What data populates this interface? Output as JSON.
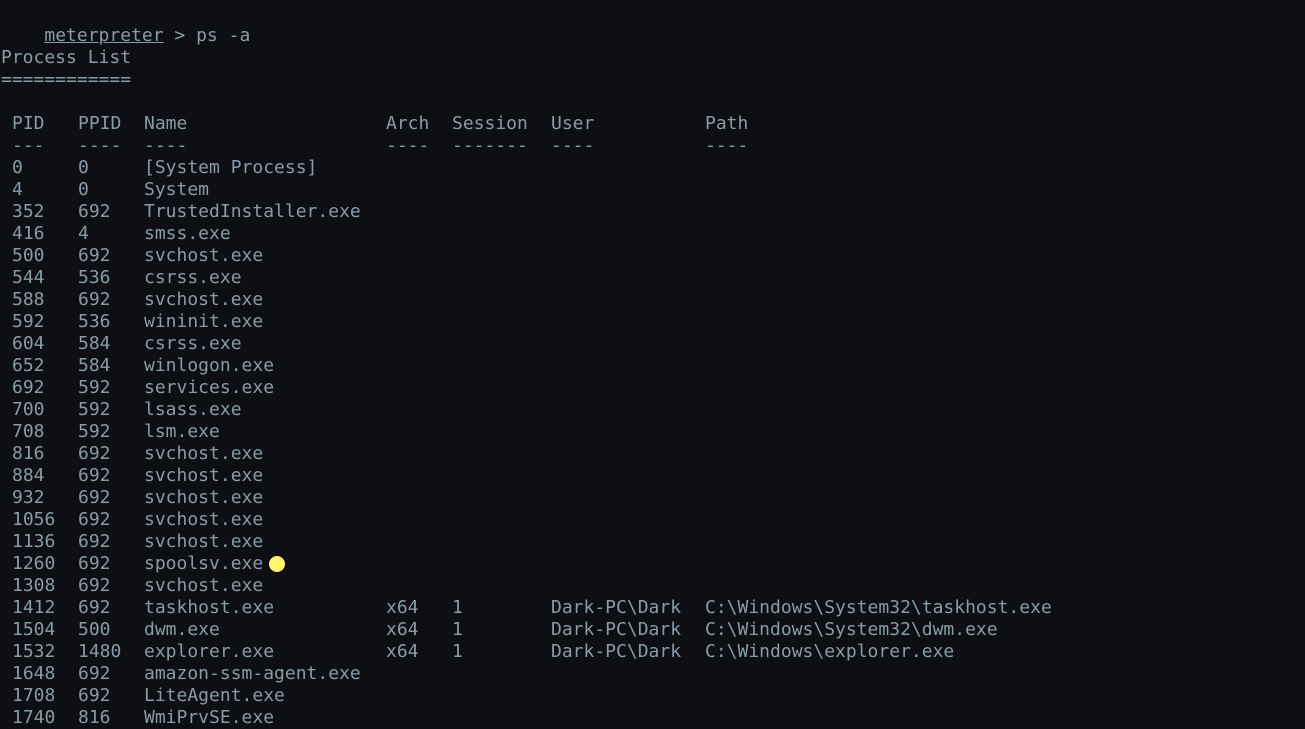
{
  "prompt": {
    "name": "meterpreter",
    "separator": " > ",
    "command": "ps -a"
  },
  "title": "Process List",
  "title_rule": "============",
  "columns": {
    "pid": "PID",
    "ppid": "PPID",
    "name": "Name",
    "arch": "Arch",
    "session": "Session",
    "user": "User",
    "path": "Path"
  },
  "dividers": {
    "pid": "---",
    "ppid": "----",
    "name": "----",
    "arch": "----",
    "session": "-------",
    "user": "----",
    "path": "----"
  },
  "rows": [
    {
      "pid": "0",
      "ppid": "0",
      "name": "[System Process]",
      "arch": "",
      "session": "",
      "user": "",
      "path": ""
    },
    {
      "pid": "4",
      "ppid": "0",
      "name": "System",
      "arch": "",
      "session": "",
      "user": "",
      "path": ""
    },
    {
      "pid": "352",
      "ppid": "692",
      "name": "TrustedInstaller.exe",
      "arch": "",
      "session": "",
      "user": "",
      "path": ""
    },
    {
      "pid": "416",
      "ppid": "4",
      "name": "smss.exe",
      "arch": "",
      "session": "",
      "user": "",
      "path": ""
    },
    {
      "pid": "500",
      "ppid": "692",
      "name": "svchost.exe",
      "arch": "",
      "session": "",
      "user": "",
      "path": ""
    },
    {
      "pid": "544",
      "ppid": "536",
      "name": "csrss.exe",
      "arch": "",
      "session": "",
      "user": "",
      "path": ""
    },
    {
      "pid": "588",
      "ppid": "692",
      "name": "svchost.exe",
      "arch": "",
      "session": "",
      "user": "",
      "path": ""
    },
    {
      "pid": "592",
      "ppid": "536",
      "name": "wininit.exe",
      "arch": "",
      "session": "",
      "user": "",
      "path": ""
    },
    {
      "pid": "604",
      "ppid": "584",
      "name": "csrss.exe",
      "arch": "",
      "session": "",
      "user": "",
      "path": ""
    },
    {
      "pid": "652",
      "ppid": "584",
      "name": "winlogon.exe",
      "arch": "",
      "session": "",
      "user": "",
      "path": ""
    },
    {
      "pid": "692",
      "ppid": "592",
      "name": "services.exe",
      "arch": "",
      "session": "",
      "user": "",
      "path": ""
    },
    {
      "pid": "700",
      "ppid": "592",
      "name": "lsass.exe",
      "arch": "",
      "session": "",
      "user": "",
      "path": ""
    },
    {
      "pid": "708",
      "ppid": "592",
      "name": "lsm.exe",
      "arch": "",
      "session": "",
      "user": "",
      "path": ""
    },
    {
      "pid": "816",
      "ppid": "692",
      "name": "svchost.exe",
      "arch": "",
      "session": "",
      "user": "",
      "path": ""
    },
    {
      "pid": "884",
      "ppid": "692",
      "name": "svchost.exe",
      "arch": "",
      "session": "",
      "user": "",
      "path": ""
    },
    {
      "pid": "932",
      "ppid": "692",
      "name": "svchost.exe",
      "arch": "",
      "session": "",
      "user": "",
      "path": ""
    },
    {
      "pid": "1056",
      "ppid": "692",
      "name": "svchost.exe",
      "arch": "",
      "session": "",
      "user": "",
      "path": ""
    },
    {
      "pid": "1136",
      "ppid": "692",
      "name": "svchost.exe",
      "arch": "",
      "session": "",
      "user": "",
      "path": ""
    },
    {
      "pid": "1260",
      "ppid": "692",
      "name": "spoolsv.exe",
      "arch": "",
      "session": "",
      "user": "",
      "path": ""
    },
    {
      "pid": "1308",
      "ppid": "692",
      "name": "svchost.exe",
      "arch": "",
      "session": "",
      "user": "",
      "path": ""
    },
    {
      "pid": "1412",
      "ppid": "692",
      "name": "taskhost.exe",
      "arch": "x64",
      "session": "1",
      "user": "Dark-PC\\Dark",
      "path": "C:\\Windows\\System32\\taskhost.exe"
    },
    {
      "pid": "1504",
      "ppid": "500",
      "name": "dwm.exe",
      "arch": "x64",
      "session": "1",
      "user": "Dark-PC\\Dark",
      "path": "C:\\Windows\\System32\\dwm.exe"
    },
    {
      "pid": "1532",
      "ppid": "1480",
      "name": "explorer.exe",
      "arch": "x64",
      "session": "1",
      "user": "Dark-PC\\Dark",
      "path": "C:\\Windows\\explorer.exe"
    },
    {
      "pid": "1648",
      "ppid": "692",
      "name": "amazon-ssm-agent.exe",
      "arch": "",
      "session": "",
      "user": "",
      "path": ""
    },
    {
      "pid": "1708",
      "ppid": "692",
      "name": "LiteAgent.exe",
      "arch": "",
      "session": "",
      "user": "",
      "path": ""
    },
    {
      "pid": "1740",
      "ppid": "816",
      "name": "WmiPrvSE.exe",
      "arch": "",
      "session": "",
      "user": "",
      "path": ""
    }
  ],
  "colors": {
    "background": "#0d0f14",
    "text": "#8a9ba8",
    "cursor": "#fff46a"
  }
}
